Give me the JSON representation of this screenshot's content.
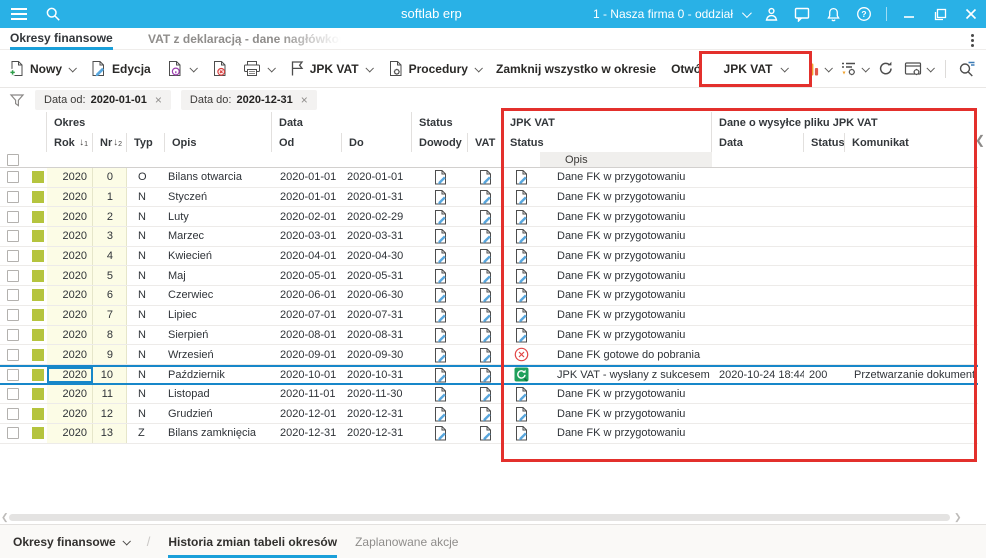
{
  "titlebar": {
    "app_title": "softlab erp",
    "company_selector": "1 - Nasza firma 0 - oddział"
  },
  "tab_bar": {
    "tabs": [
      {
        "label": "Okresy finansowe",
        "active": true
      },
      {
        "label": "VAT z deklaracją - dane nagłówkowe",
        "active": false
      }
    ]
  },
  "toolbar": {
    "items": [
      {
        "label": "Nowy"
      },
      {
        "label": "Edycja"
      },
      {
        "label": ""
      },
      {
        "label": ""
      },
      {
        "label": ""
      },
      {
        "label": "JPK VAT"
      },
      {
        "label": "Procedury"
      },
      {
        "label": "Zamknij wszystko w okresie"
      },
      {
        "label": "Otwórz o..."
      }
    ],
    "jpk_vat_button": "JPK VAT"
  },
  "filter_bar": {
    "chips": [
      {
        "label": "Data od:",
        "value": "2020-01-01",
        "close": "×"
      },
      {
        "label": "Data do:",
        "value": "2020-12-31",
        "close": "×"
      }
    ]
  },
  "table": {
    "groups": {
      "okres": "Okres",
      "data": "Data",
      "status": "Status",
      "jpk": "JPK VAT",
      "wysylka": "Dane o wysyłce pliku JPK VAT"
    },
    "columns": {
      "rok": "Rok",
      "nr": "Nr",
      "typ": "Typ",
      "opis": "Opis",
      "od": "Od",
      "do": "Do",
      "dowody": "Dowody",
      "vat": "VAT",
      "jpk_status": "Status",
      "jpk_opis": "Opis",
      "wys_data": "Data",
      "wys_status": "Status",
      "wys_komunikat": "Komunikat"
    },
    "sort": {
      "rok": "1",
      "nr": "2"
    },
    "rows": [
      {
        "rok": "2020",
        "nr": "0",
        "typ": "O",
        "opis": "Bilans otwarcia",
        "od": "2020-01-01",
        "do": "2020-01-01",
        "dowody_icon": "doc-edit",
        "vat_icon": "doc-edit",
        "jpk_icon": "doc-edit",
        "jpk_opis": "Dane FK w przygotowaniu",
        "wys_data": "",
        "wys_status": "",
        "wys_komunikat": "",
        "selected": false
      },
      {
        "rok": "2020",
        "nr": "1",
        "typ": "N",
        "opis": "Styczeń",
        "od": "2020-01-01",
        "do": "2020-01-31",
        "dowody_icon": "doc-edit",
        "vat_icon": "doc-edit",
        "jpk_icon": "doc-edit",
        "jpk_opis": "Dane FK w przygotowaniu",
        "wys_data": "",
        "wys_status": "",
        "wys_komunikat": "",
        "selected": false
      },
      {
        "rok": "2020",
        "nr": "2",
        "typ": "N",
        "opis": "Luty",
        "od": "2020-02-01",
        "do": "2020-02-29",
        "dowody_icon": "doc-edit",
        "vat_icon": "doc-edit",
        "jpk_icon": "doc-edit",
        "jpk_opis": "Dane FK w przygotowaniu",
        "wys_data": "",
        "wys_status": "",
        "wys_komunikat": "",
        "selected": false
      },
      {
        "rok": "2020",
        "nr": "3",
        "typ": "N",
        "opis": "Marzec",
        "od": "2020-03-01",
        "do": "2020-03-31",
        "dowody_icon": "doc-edit",
        "vat_icon": "doc-edit",
        "jpk_icon": "doc-edit",
        "jpk_opis": "Dane FK w przygotowaniu",
        "wys_data": "",
        "wys_status": "",
        "wys_komunikat": "",
        "selected": false
      },
      {
        "rok": "2020",
        "nr": "4",
        "typ": "N",
        "opis": "Kwiecień",
        "od": "2020-04-01",
        "do": "2020-04-30",
        "dowody_icon": "doc-edit",
        "vat_icon": "doc-edit",
        "jpk_icon": "doc-edit",
        "jpk_opis": "Dane FK w przygotowaniu",
        "wys_data": "",
        "wys_status": "",
        "wys_komunikat": "",
        "selected": false
      },
      {
        "rok": "2020",
        "nr": "5",
        "typ": "N",
        "opis": "Maj",
        "od": "2020-05-01",
        "do": "2020-05-31",
        "dowody_icon": "doc-edit",
        "vat_icon": "doc-edit",
        "jpk_icon": "doc-edit",
        "jpk_opis": "Dane FK w przygotowaniu",
        "wys_data": "",
        "wys_status": "",
        "wys_komunikat": "",
        "selected": false
      },
      {
        "rok": "2020",
        "nr": "6",
        "typ": "N",
        "opis": "Czerwiec",
        "od": "2020-06-01",
        "do": "2020-06-30",
        "dowody_icon": "doc-edit",
        "vat_icon": "doc-edit",
        "jpk_icon": "doc-edit",
        "jpk_opis": "Dane FK w przygotowaniu",
        "wys_data": "",
        "wys_status": "",
        "wys_komunikat": "",
        "selected": false
      },
      {
        "rok": "2020",
        "nr": "7",
        "typ": "N",
        "opis": "Lipiec",
        "od": "2020-07-01",
        "do": "2020-07-31",
        "dowody_icon": "doc-edit",
        "vat_icon": "doc-edit",
        "jpk_icon": "doc-edit",
        "jpk_opis": "Dane FK w przygotowaniu",
        "wys_data": "",
        "wys_status": "",
        "wys_komunikat": "",
        "selected": false
      },
      {
        "rok": "2020",
        "nr": "8",
        "typ": "N",
        "opis": "Sierpień",
        "od": "2020-08-01",
        "do": "2020-08-31",
        "dowody_icon": "doc-edit",
        "vat_icon": "doc-edit",
        "jpk_icon": "doc-edit",
        "jpk_opis": "Dane FK w przygotowaniu",
        "wys_data": "",
        "wys_status": "",
        "wys_komunikat": "",
        "selected": false
      },
      {
        "rok": "2020",
        "nr": "9",
        "typ": "N",
        "opis": "Wrzesień",
        "od": "2020-09-01",
        "do": "2020-09-30",
        "dowody_icon": "doc-edit",
        "vat_icon": "doc-edit",
        "jpk_icon": "error-circle",
        "jpk_opis": "Dane FK gotowe do pobrania",
        "wys_data": "",
        "wys_status": "",
        "wys_komunikat": "",
        "selected": false
      },
      {
        "rok": "2020",
        "nr": "10",
        "typ": "N",
        "opis": "Październik",
        "od": "2020-10-01",
        "do": "2020-10-31",
        "dowody_icon": "doc-edit",
        "vat_icon": "doc-edit",
        "jpk_icon": "sync-green",
        "jpk_opis": "JPK VAT - wysłany z sukcesem",
        "wys_data": "2020-10-24 18:44",
        "wys_status": "200",
        "wys_komunikat": "Przetwarzanie dokument",
        "selected": true
      },
      {
        "rok": "2020",
        "nr": "11",
        "typ": "N",
        "opis": "Listopad",
        "od": "2020-11-01",
        "do": "2020-11-30",
        "dowody_icon": "doc-edit",
        "vat_icon": "doc-edit",
        "jpk_icon": "doc-edit",
        "jpk_opis": "Dane FK w przygotowaniu",
        "wys_data": "",
        "wys_status": "",
        "wys_komunikat": "",
        "selected": false
      },
      {
        "rok": "2020",
        "nr": "12",
        "typ": "N",
        "opis": "Grudzień",
        "od": "2020-12-01",
        "do": "2020-12-31",
        "dowody_icon": "doc-edit",
        "vat_icon": "doc-edit",
        "jpk_icon": "doc-edit",
        "jpk_opis": "Dane FK w przygotowaniu",
        "wys_data": "",
        "wys_status": "",
        "wys_komunikat": "",
        "selected": false
      },
      {
        "rok": "2020",
        "nr": "13",
        "typ": "Z",
        "opis": "Bilans zamknięcia",
        "od": "2020-12-31",
        "do": "2020-12-31",
        "dowody_icon": "doc-edit",
        "vat_icon": "doc-edit",
        "jpk_icon": "doc-edit",
        "jpk_opis": "Dane FK w przygotowaniu",
        "wys_data": "",
        "wys_status": "",
        "wys_komunikat": "",
        "selected": false
      }
    ]
  },
  "bottom_bar": {
    "tabs": [
      {
        "label": "Okresy finansowe",
        "dropdown": true
      },
      {
        "label": "Historia zmian tabeli okresów",
        "active": true
      },
      {
        "label": "Zaplanowane akcje"
      }
    ],
    "separator": "/"
  },
  "colors": {
    "topbar_blue": "#29b1e6",
    "accent_blue": "#1a9fd9",
    "selection_blue": "#1787c9",
    "annotation_red": "#e3302c",
    "indicator_green": "#b5c43e",
    "row_yellow": "#fcfce6",
    "success_green": "#1fa05c",
    "error_red": "#e24444"
  }
}
